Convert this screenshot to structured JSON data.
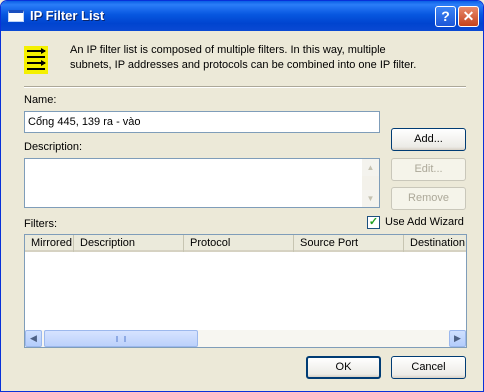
{
  "window": {
    "title": "IP Filter List"
  },
  "title_buttons": {
    "help_symbol": "?",
    "close_symbol": "✕"
  },
  "intro_text": "An IP filter list is composed of multiple filters. In this way, multiple subnets, IP addresses and protocols can be combined into one IP filter.",
  "icons": {
    "header": "filter-list-icon"
  },
  "name": {
    "label": "Name:",
    "value": "Cổng 445, 139 ra - vào"
  },
  "description": {
    "label": "Description:",
    "value": ""
  },
  "buttons": {
    "add": "Add...",
    "edit": "Edit...",
    "remove": "Remove",
    "ok": "OK",
    "cancel": "Cancel"
  },
  "filters": {
    "label": "Filters:",
    "columns": [
      "Mirrored",
      "Description",
      "Protocol",
      "Source Port",
      "Destination"
    ],
    "rows": []
  },
  "use_add_wizard": {
    "label": "Use Add Wizard",
    "checked": true
  },
  "colors": {
    "titlebar": "#0a5fe5",
    "dialog_bg": "#ece9d8",
    "accent_border": "#003c74"
  }
}
